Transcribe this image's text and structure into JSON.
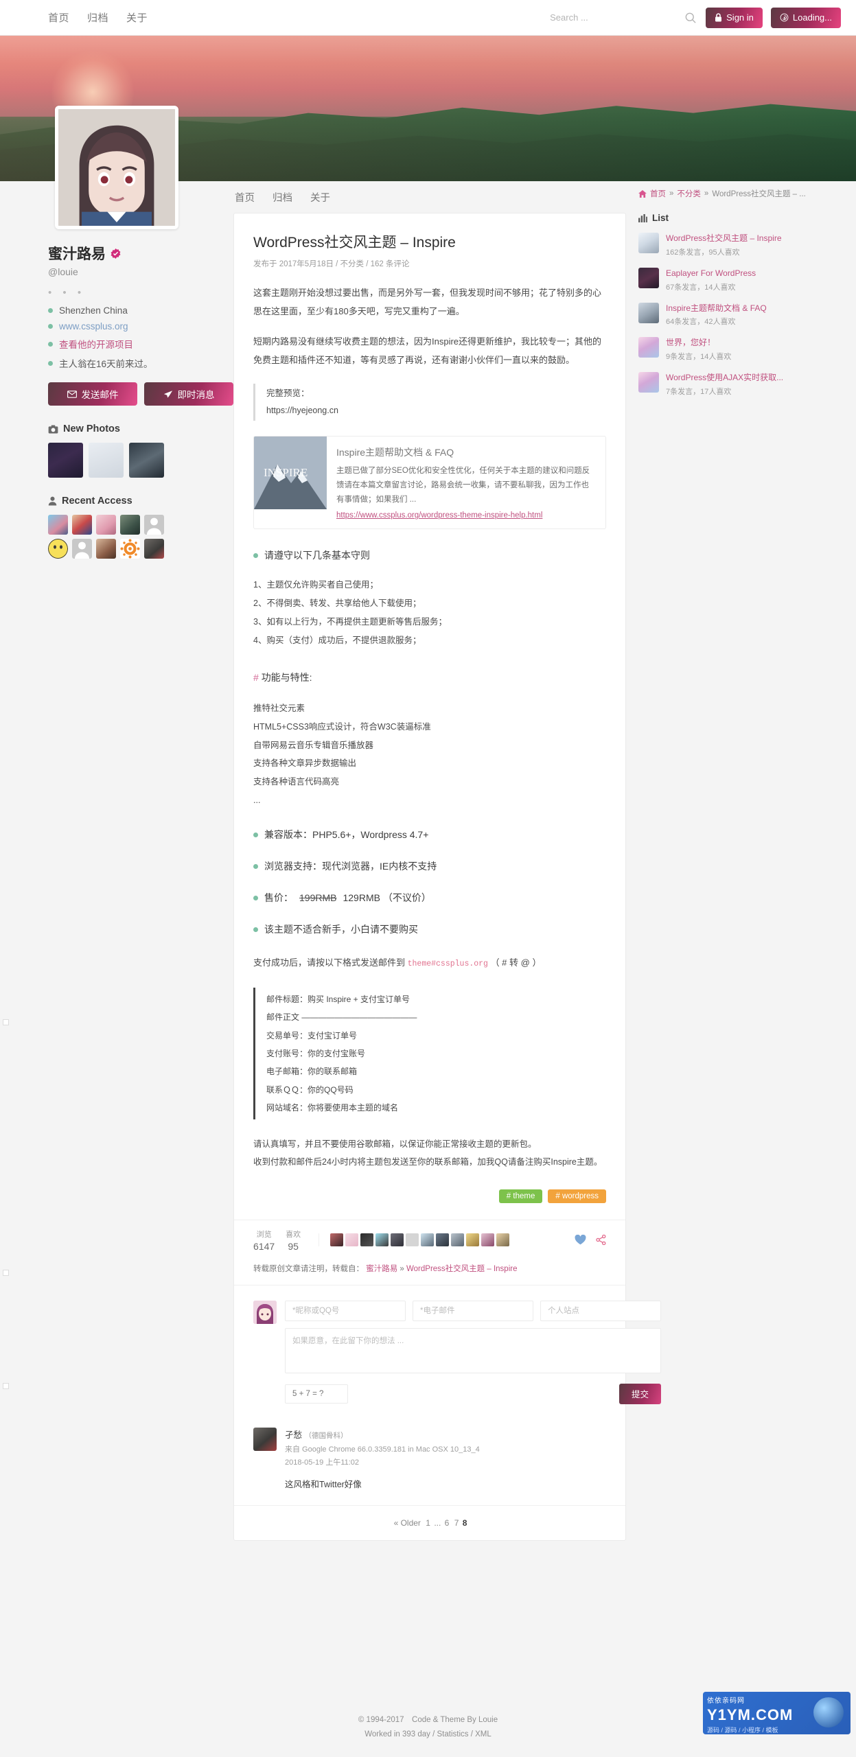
{
  "topbar": {
    "nav": [
      "首页",
      "归档",
      "关于"
    ],
    "search_placeholder": "Search ...",
    "signin_label": "Sign in",
    "loading_label": "Loading..."
  },
  "profile": {
    "name": "蜜汁路易",
    "handle": "@louie",
    "dots": "• • •",
    "meta": [
      {
        "text": "Shenzhen China",
        "type": "plain"
      },
      {
        "text": "www.cssplus.org",
        "type": "url"
      },
      {
        "text": "查看他的开源项目",
        "type": "link"
      },
      {
        "text": "主人翁在16天前来过。",
        "type": "plain"
      }
    ],
    "mail_button": "发送邮件",
    "im_button": "即时消息",
    "photos_title": "New Photos",
    "access_title": "Recent Access"
  },
  "subnav": [
    "首页",
    "归档",
    "关于"
  ],
  "breadcrumb": {
    "home": "首页",
    "category": "不分类",
    "current": "WordPress社交风主题 – ...",
    "sep": "»"
  },
  "article": {
    "title": "WordPress社交风主题 – Inspire",
    "meta": "发布于 2017年5月18日 / 不分类 / 162 条评论",
    "para1": "这套主题刚开始没想过要出售，而是另外写一套，但我发现时间不够用；花了特别多的心思在这里面，至少有180多天吧，写完又重构了一遍。",
    "para2": "短期内路易没有继续写收费主题的想法，因为Inspire还得更新维护，我比较专一；其他的免费主题和插件还不知道，等有灵感了再说，还有谢谢小伙伴们一直以来的鼓励。",
    "preview_label": "完整预览：",
    "preview_url": "https://hyejeong.cn",
    "embed_title": "Inspire主题帮助文档 & FAQ",
    "embed_desc": "主题已做了部分SEO优化和安全性优化，任何关于本主题的建议和问题反馈请在本篇文章留言讨论，路易会统一收集，请不要私聊我，因为工作也有事情做；如果我们 ...",
    "embed_link": "https://www.cssplus.org/wordpress-theme-inspire-help.html",
    "rules_heading": "请遵守以下几条基本守则",
    "rules": [
      "1、主题仅允许购买者自己使用；",
      "2、不得倒卖、转发、共享给他人下载使用；",
      "3、如有以上行为，不再提供主题更新等售后服务；",
      "4、购买（支付）成功后，不提供退款服务；"
    ],
    "features_heading_hash": "#",
    "features_heading": "功能与特性:",
    "features": [
      "推特社交元素",
      "HTML5+CSS3响应式设计，符合W3C装逼标准",
      "自带网易云音乐专辑音乐播放器",
      "支持各种文章异步数据输出",
      "支持各种语言代码高亮",
      "..."
    ],
    "specs": [
      {
        "text": "兼容版本：PHP5.6+，Wordpress 4.7+"
      },
      {
        "text": "浏览器支持：现代浏览器，IE内核不支持"
      },
      {
        "text": "售价：",
        "strike": "199RMB",
        "after": " 129RMB （不议价）"
      },
      {
        "text": "该主题不适合新手，小白请不要购买"
      }
    ],
    "payment_note_pre": "支付成功后，请按以下格式发送邮件到 ",
    "payment_email": "theme#cssplus.org",
    "payment_note_post": " （ # 转 @ ）",
    "mail_template": [
      "邮件标题：购买 Inspire + 支付宝订单号",
      "邮件正文 ——————————————",
      "交易单号：支付宝订单号",
      "支付账号：你的支付宝账号",
      "电子邮箱：你的联系邮箱",
      "联系ＱＱ：你的QQ号码",
      "网站域名：你将要使用本主题的域名"
    ],
    "closing1": "请认真填写，并且不要使用谷歌邮箱，以保证你能正常接收主题的更新包。",
    "closing2": "收到付款和邮件后24小时内将主题包发送至你的联系邮箱，加我QQ请备注购买Inspire主题。",
    "tags": [
      {
        "label": "# theme",
        "color": "green"
      },
      {
        "label": "# wordpress",
        "color": "orange"
      }
    ],
    "stats": {
      "views_label": "浏览",
      "views_value": "6147",
      "likes_label": "喜欢",
      "likes_value": "95"
    },
    "repost_prefix": "转载原创文章请注明，转载自：",
    "repost_author": "蜜汁路易",
    "repost_sep": "»",
    "repost_title": "WordPress社交风主题 – Inspire"
  },
  "comment_form": {
    "name_placeholder": "*昵称或QQ号",
    "email_placeholder": "*电子邮件",
    "site_placeholder": "个人站点",
    "body_placeholder": "如果愿意，在此留下你的想法 ...",
    "captcha_placeholder": "5 + 7 = ?",
    "submit_label": "提交"
  },
  "comments": [
    {
      "name": "孑愁",
      "badge": "（德国骨科）",
      "ua": "来自 Google Chrome 66.0.3359.181 in Mac OSX 10_13_4",
      "date": "2018-05-19 上午11:02",
      "text": "这风格和Twitter好像"
    }
  ],
  "pager": {
    "older": "« Older",
    "page1": "1",
    "ellipsis": "...",
    "page6": "6",
    "page7": "7",
    "page8": "8"
  },
  "sidebar": {
    "list_title": "List",
    "items": [
      {
        "title": "WordPress社交风主题 – Inspire",
        "sub": "162条发言，95人喜欢"
      },
      {
        "title": "Eaplayer For WordPress",
        "sub": "67条发言，14人喜欢"
      },
      {
        "title": "Inspire主题帮助文档 & FAQ",
        "sub": "64条发言，42人喜欢"
      },
      {
        "title": "世界，您好！",
        "sub": "9条发言，14人喜欢"
      },
      {
        "title": "WordPress使用AJAX实时获取...",
        "sub": "7条发言，17人喜欢"
      }
    ]
  },
  "footer": {
    "copyright": "© 1994-2017　Code & Theme By Louie",
    "worked_prefix": "Worked in 393 day / ",
    "statistics": "Statistics",
    "slash": " / ",
    "xml": "XML"
  },
  "watermark": {
    "top": "依依亲码网",
    "main": "Y1YM.COM",
    "sub": "源码 / 源码 / 小程序 / 模板"
  },
  "colors": {
    "accent_pink": "#c0507f",
    "green_tag": "#7dc24b",
    "orange_tag": "#f2a33c",
    "bullet_green": "#7cc0a4"
  }
}
